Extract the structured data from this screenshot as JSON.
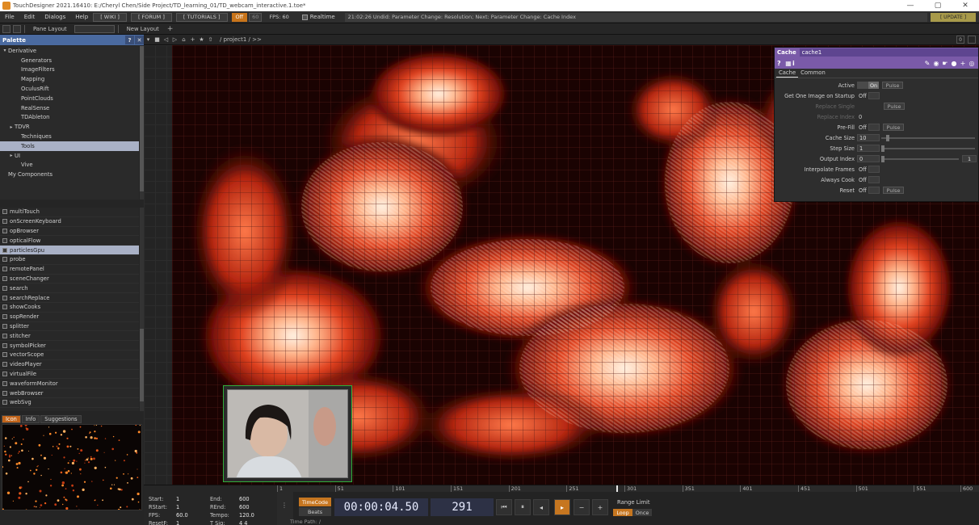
{
  "window": {
    "title": "TouchDesigner 2021.16410: E:/Cheryl Chen/Side Project/TD_learning_01/TD_webcam_interactive.1.toe*",
    "controls": [
      "—",
      "▢",
      "✕"
    ]
  },
  "menubar": {
    "items": [
      "File",
      "Edit",
      "Dialogs",
      "Help"
    ],
    "buttons": [
      "[ WIKI ]",
      "[ FORUM ]",
      "[ TUTORIALS ]"
    ],
    "off_label": "Off",
    "sixty_label": "60",
    "fps_label": "FPS:  60",
    "realtime_label": "Realtime",
    "undo_text": "21:02:26  Undid: Parameter Change: Resolution;  Next: Parameter Change: Cache Index",
    "update_label": "[ UPDATE ]"
  },
  "toolbar": {
    "pane_layout": "Pane Layout",
    "new_layout": "New Layout",
    "plus": "+"
  },
  "palette": {
    "title": "Palette",
    "help": "?",
    "close": "✕",
    "tree": [
      {
        "label": "Derivative",
        "indent": 0,
        "arrow": "▾"
      },
      {
        "label": "Generators",
        "indent": 2,
        "arrow": ""
      },
      {
        "label": "ImageFilters",
        "indent": 2,
        "arrow": ""
      },
      {
        "label": "Mapping",
        "indent": 2,
        "arrow": ""
      },
      {
        "label": "OculusRift",
        "indent": 2,
        "arrow": ""
      },
      {
        "label": "PointClouds",
        "indent": 2,
        "arrow": ""
      },
      {
        "label": "RealSense",
        "indent": 2,
        "arrow": ""
      },
      {
        "label": "TDAbleton",
        "indent": 2,
        "arrow": ""
      },
      {
        "label": "TDVR",
        "indent": 1,
        "arrow": "▸"
      },
      {
        "label": "Techniques",
        "indent": 2,
        "arrow": ""
      },
      {
        "label": "Tools",
        "indent": 2,
        "arrow": "",
        "selected": true
      },
      {
        "label": "UI",
        "indent": 1,
        "arrow": "▸"
      },
      {
        "label": "Vive",
        "indent": 2,
        "arrow": ""
      },
      {
        "label": "My Components",
        "indent": 0,
        "arrow": ""
      }
    ],
    "ops": [
      {
        "label": "multiTouch"
      },
      {
        "label": "onScreenKeyboard"
      },
      {
        "label": "opBrowser"
      },
      {
        "label": "opticalFlow"
      },
      {
        "label": "particlesGpu",
        "selected": true
      },
      {
        "label": "probe"
      },
      {
        "label": "remotePanel"
      },
      {
        "label": "sceneChanger"
      },
      {
        "label": "search"
      },
      {
        "label": "searchReplace"
      },
      {
        "label": "showCooks"
      },
      {
        "label": "sopRender"
      },
      {
        "label": "splitter"
      },
      {
        "label": "stitcher"
      },
      {
        "label": "symbolPicker"
      },
      {
        "label": "vectorScope"
      },
      {
        "label": "videoPlayer"
      },
      {
        "label": "virtualFile"
      },
      {
        "label": "waveformMonitor"
      },
      {
        "label": "webBrowser"
      },
      {
        "label": "webSvg"
      }
    ],
    "info_tabs": [
      "Icon",
      "Info",
      "Suggestions"
    ]
  },
  "network": {
    "path": "/ project1 / >>",
    "zero_btn": "0"
  },
  "params": {
    "op_type": "Cache",
    "op_name": "cache1",
    "help": "?",
    "info": "i",
    "tabs": [
      "Cache",
      "Common"
    ],
    "rows": [
      {
        "label": "Active",
        "kind": "onoff",
        "value": "On",
        "pulse": "Pulse"
      },
      {
        "label": "Get One Image on Startup",
        "kind": "toggle",
        "value": "Off"
      },
      {
        "label": "Replace Single",
        "kind": "pulseonly",
        "dim": true,
        "pulse": "Pulse"
      },
      {
        "label": "Replace Index",
        "kind": "num",
        "dim": true,
        "value": "0"
      },
      {
        "label": "Pre-Fill",
        "kind": "toggle",
        "value": "Off",
        "pulse": "Pulse"
      },
      {
        "label": "Cache Size",
        "kind": "slider",
        "value": "10"
      },
      {
        "label": "Step Size",
        "kind": "slider",
        "value": "1"
      },
      {
        "label": "Output Index",
        "kind": "slider",
        "value": "0",
        "extra": "1"
      },
      {
        "label": "Interpolate Frames",
        "kind": "toggle",
        "value": "Off"
      },
      {
        "label": "Always Cook",
        "kind": "toggle",
        "value": "Off"
      },
      {
        "label": "Reset",
        "kind": "toggle",
        "value": "Off",
        "pulse": "Pulse"
      }
    ]
  },
  "timeline": {
    "ruler": [
      "1",
      "51",
      "101",
      "151",
      "201",
      "251",
      "301",
      "351",
      "401",
      "451",
      "501",
      "551",
      "600"
    ],
    "info": [
      {
        "k": "Start:",
        "v": "1",
        "k2": "End:",
        "v2": "600"
      },
      {
        "k": "RStart:",
        "v": "1",
        "k2": "REnd:",
        "v2": "600"
      },
      {
        "k": "FPS:",
        "v": "60.0",
        "k2": "Tempo:",
        "v2": "120.0"
      },
      {
        "k": "ResetF:",
        "v": "1",
        "k2": "T Sig:",
        "v2": "4     4"
      }
    ],
    "timecode_label": "TimeCode",
    "beats_label": "Beats",
    "timecode": "00:00:04.50",
    "frame": "291",
    "range_limit": "Range Limit",
    "loop": "Loop",
    "once": "Once",
    "time_path": "Time Path: /"
  }
}
